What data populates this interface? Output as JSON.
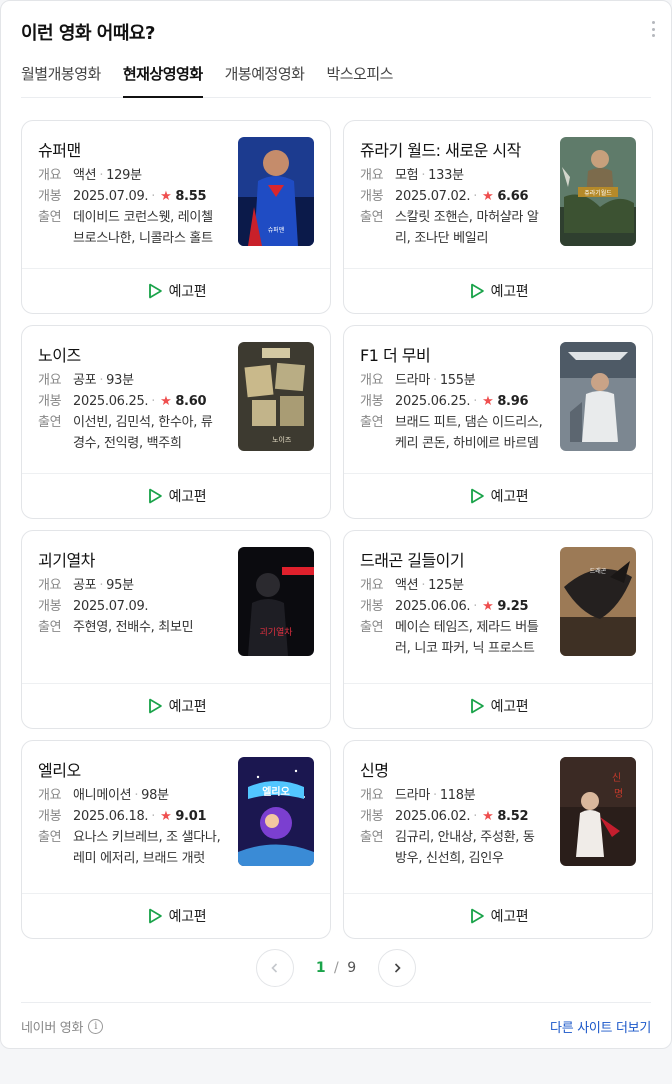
{
  "header": {
    "title": "이런 영화 어때요?",
    "more_icon": "more-vertical-icon"
  },
  "tabs": [
    {
      "label": "월별개봉영화",
      "active": false
    },
    {
      "label": "현재상영영화",
      "active": true
    },
    {
      "label": "개봉예정영화",
      "active": false
    },
    {
      "label": "박스오피스",
      "active": false
    }
  ],
  "labels": {
    "genre": "개요",
    "release": "개봉",
    "cast": "출연",
    "trailer": "예고편"
  },
  "movies": [
    {
      "title": "슈퍼맨",
      "genre": "액션",
      "runtime": "129분",
      "date": "2025.07.09.",
      "rating": "8.55",
      "cast": "데이비드 코런스웻, 레이첼 브로스나한, 니콜라스 홀트"
    },
    {
      "title": "쥬라기 월드: 새로운 시작",
      "genre": "모험",
      "runtime": "133분",
      "date": "2025.07.02.",
      "rating": "6.66",
      "cast": "스칼릿 조핸슨, 마허샬라 알리, 조나단 베일리"
    },
    {
      "title": "노이즈",
      "genre": "공포",
      "runtime": "93분",
      "date": "2025.06.25.",
      "rating": "8.60",
      "cast": "이선빈, 김민석, 한수아, 류경수, 전익령, 백주희"
    },
    {
      "title": "F1 더 무비",
      "genre": "드라마",
      "runtime": "155분",
      "date": "2025.06.25.",
      "rating": "8.96",
      "cast": "브래드 피트, 댐슨 이드리스, 케리 콘돈, 하비에르 바르뎀"
    },
    {
      "title": "괴기열차",
      "genre": "공포",
      "runtime": "95분",
      "date": "2025.07.09.",
      "rating": "",
      "cast": "주현영, 전배수, 최보민"
    },
    {
      "title": "드래곤 길들이기",
      "genre": "액션",
      "runtime": "125분",
      "date": "2025.06.06.",
      "rating": "9.25",
      "cast": "메이슨 테임즈, 제라드 버틀러, 니코 파커, 닉 프로스트"
    },
    {
      "title": "엘리오",
      "genre": "애니메이션",
      "runtime": "98분",
      "date": "2025.06.18.",
      "rating": "9.01",
      "cast": "요나스 키브레브, 조 샐다나, 레미 에저리, 브래드 개럿"
    },
    {
      "title": "신명",
      "genre": "드라마",
      "runtime": "118분",
      "date": "2025.06.02.",
      "rating": "8.52",
      "cast": "김규리, 안내상, 주성환, 동방우, 신선희, 김인우"
    }
  ],
  "pagination": {
    "current": "1",
    "separator": "/",
    "total": "9"
  },
  "footer": {
    "source": "네이버 영화",
    "info_icon": "i",
    "other_link": "다른 사이트 더보기"
  },
  "colors": {
    "star": "#ef4f4f",
    "play_icon": "#1aa34a",
    "pager_current": "#1aa34a",
    "link": "#1a57c9"
  }
}
